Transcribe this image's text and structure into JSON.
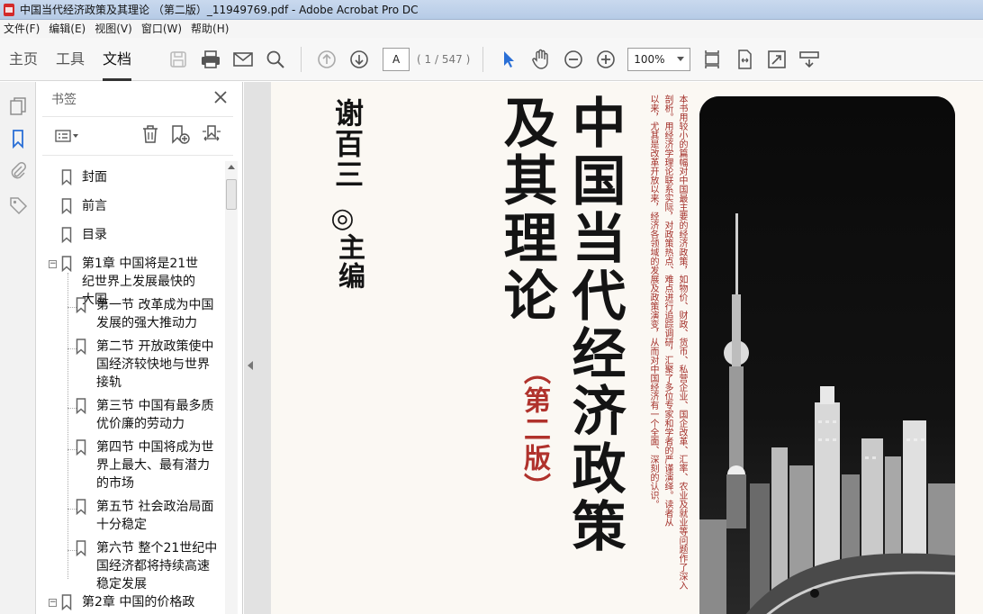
{
  "window": {
    "title": "中国当代经济政策及其理论 （第二版）_11949769.pdf - Adobe Acrobat Pro DC"
  },
  "menu": [
    {
      "label": "文件(F)"
    },
    {
      "label": "编辑(E)"
    },
    {
      "label": "视图(V)"
    },
    {
      "label": "窗口(W)"
    },
    {
      "label": "帮助(H)"
    }
  ],
  "toolbar": {
    "tabs": [
      {
        "label": "主页",
        "active": false
      },
      {
        "label": "工具",
        "active": false
      },
      {
        "label": "文档",
        "active": true
      }
    ],
    "page_input": "A",
    "page_count": "( 1 / 547 )",
    "zoom": "100%"
  },
  "bookmarks_panel": {
    "title": "书签",
    "items": [
      {
        "label": "封面",
        "level": 0
      },
      {
        "label": "前言",
        "level": 0
      },
      {
        "label": "目录",
        "level": 0
      },
      {
        "label": "第1章  中国将是21世纪世界上发展最快的大国",
        "level": 0,
        "expanded": true
      },
      {
        "label": "第一节  改革成为中国发展的强大推动力",
        "level": 1
      },
      {
        "label": "第二节  开放政策使中国经济较快地与世界接轨",
        "level": 1
      },
      {
        "label": "第三节  中国有最多质优价廉的劳动力",
        "level": 1
      },
      {
        "label": "第四节  中国将成为世界上最大、最有潜力的市场",
        "level": 1
      },
      {
        "label": "第五节  社会政治局面十分稳定",
        "level": 1
      },
      {
        "label": "第六节  整个21世纪中国经济都将持续高速稳定发展",
        "level": 1
      },
      {
        "label": "第2章  中国的价格政",
        "level": 0,
        "expanded": true
      }
    ]
  },
  "cover": {
    "author_name": "谢百三",
    "author_separator": "◎",
    "author_role": "主编",
    "title_line1": "中国当代经济政策",
    "title_line2": "及其理论",
    "edition": "（第二版）",
    "blurb_columns": [
      "本书用较小的篇幅对中国最主要的经济政策，如物价、财政、货币、私营企业、国企改革、汇率、农业及就业等问题作了深入",
      "剖析。用经济学理论联系实际，对政策热点、难点进行追踪调研，汇聚了多位专家和学者的严谨演绎。读者从",
      "以来，尤其是改革开放以来，经济各领域的发展及政策演变，从而对中国经济有一个全面、深刻的认识。"
    ]
  },
  "colors": {
    "accent_blue": "#2a6fd6",
    "edition_red": "#b0322c"
  }
}
